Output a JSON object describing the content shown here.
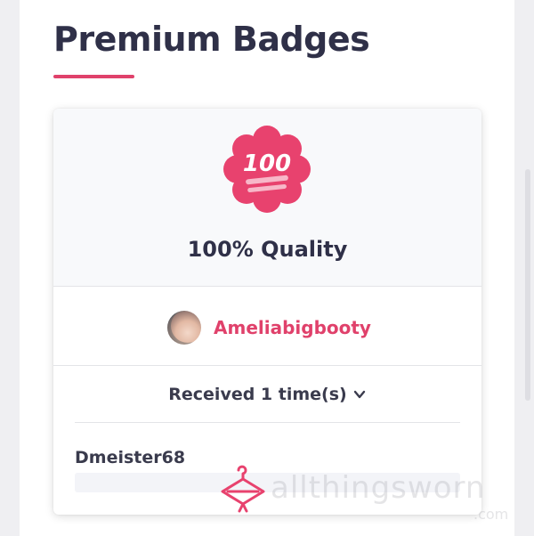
{
  "page": {
    "title": "Premium Badges",
    "accent_color": "#e0416b"
  },
  "badge": {
    "icon": "hundred-points-icon",
    "icon_text": "100",
    "name": "100% Quality"
  },
  "owner": {
    "avatar": "avatar",
    "name": "Ameliabigbooty"
  },
  "received": {
    "label": "Received 1 time(s)",
    "toggle_icon": "chevron-down-icon"
  },
  "givers": [
    {
      "name": "Dmeister68"
    }
  ],
  "watermark": {
    "icon": "hanger-logo-icon",
    "text": "allthingsworn",
    "sub": ".com"
  }
}
